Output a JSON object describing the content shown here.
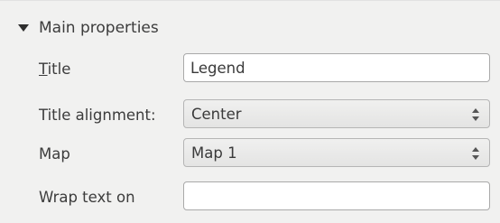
{
  "section": {
    "title": "Main properties",
    "expanded_icon": "triangle-down-icon"
  },
  "fields": {
    "title": {
      "label_mnemonic": "T",
      "label_rest": "itle",
      "value": "Legend"
    },
    "title_alignment": {
      "label": "Title alignment:",
      "value": "Center"
    },
    "map": {
      "label": "Map",
      "value": "Map 1"
    },
    "wrap_text": {
      "label": "Wrap text on",
      "value": ""
    }
  }
}
